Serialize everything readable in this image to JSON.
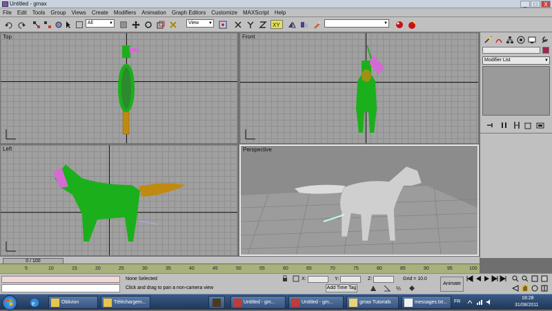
{
  "window": {
    "title": "Untitled - gmax",
    "minimize": "_",
    "maximize": "□",
    "close": "X"
  },
  "menu": [
    "File",
    "Edit",
    "Tools",
    "Group",
    "Views",
    "Create",
    "Modifiers",
    "Animation",
    "Graph Editors",
    "Customize",
    "MAXScript",
    "Help"
  ],
  "toolbar": {
    "selection_filter": "All",
    "coord_system": "View"
  },
  "viewports": {
    "top": "Top",
    "front": "Front",
    "left": "Left",
    "perspective": "Perspective"
  },
  "command_panel": {
    "modifier_list": "Modifier List"
  },
  "timeline": {
    "frame_counter": "0 / 100",
    "ticks": [
      "5",
      "10",
      "15",
      "20",
      "25",
      "30",
      "35",
      "40",
      "45",
      "50",
      "55",
      "60",
      "65",
      "70",
      "75",
      "80",
      "85",
      "90",
      "95",
      "100"
    ]
  },
  "status": {
    "selection": "None Selected",
    "prompt": "Click and drag to pan a non-camera view",
    "add_time_tag": "Add Time Tag",
    "x_label": "X:",
    "y_label": "Y:",
    "z_label": "Z:",
    "grid": "Grid = 10.0",
    "animate": "Animate"
  },
  "taskbar": {
    "tasks": [
      "Oblivion",
      "Téléchargem...",
      "",
      "Untitled - gm...",
      "Untitled - gm...",
      "gmax Tutorials",
      "messages.txt..."
    ],
    "lang": "FR",
    "time": "18:28",
    "date": "31/08/2011"
  },
  "colors": {
    "wire_green": "#1bb01b",
    "horn_pink": "#d46bd4",
    "tail_gold": "#c08a10",
    "mesh_grey": "#cfcfcf",
    "timeline": "#a9b07b"
  }
}
